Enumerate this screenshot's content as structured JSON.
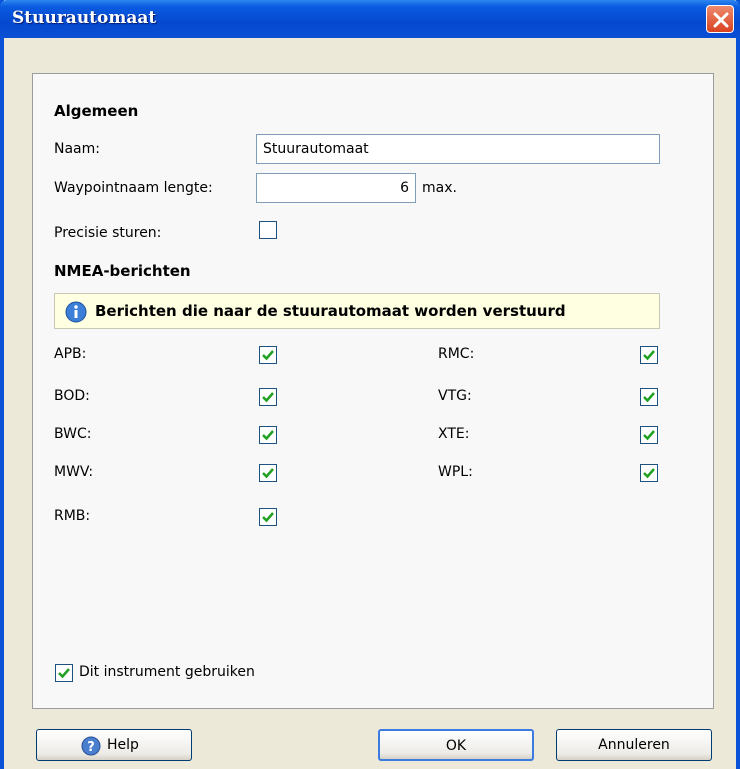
{
  "window": {
    "title": "Stuurautomaat"
  },
  "general": {
    "heading": "Algemeen",
    "name_label": "Naam:",
    "name_value": "Stuurautomaat",
    "waypoint_label": "Waypointnaam lengte:",
    "waypoint_value": "6",
    "waypoint_suffix": "max.",
    "precise_label": "Precisie sturen:",
    "precise_checked": false
  },
  "nmea": {
    "heading": "NMEA-berichten",
    "info": "Berichten die naar de stuurautomaat worden verstuurd",
    "left": [
      {
        "label": "APB:",
        "checked": true
      },
      {
        "label": "BOD:",
        "checked": true
      },
      {
        "label": "BWC:",
        "checked": true
      },
      {
        "label": "MWV:",
        "checked": true
      },
      {
        "label": "RMB:",
        "checked": true
      }
    ],
    "right": [
      {
        "label": "RMC:",
        "checked": true
      },
      {
        "label": "VTG:",
        "checked": true
      },
      {
        "label": "XTE:",
        "checked": true
      },
      {
        "label": "WPL:",
        "checked": true
      }
    ]
  },
  "use_instrument": {
    "label": "Dit instrument gebruiken",
    "checked": true
  },
  "buttons": {
    "help": "Help",
    "ok": "OK",
    "cancel": "Annuleren"
  },
  "colors": {
    "accent": "#0a52d8",
    "check": "#21a121",
    "info_bg": "#ffffe1"
  }
}
